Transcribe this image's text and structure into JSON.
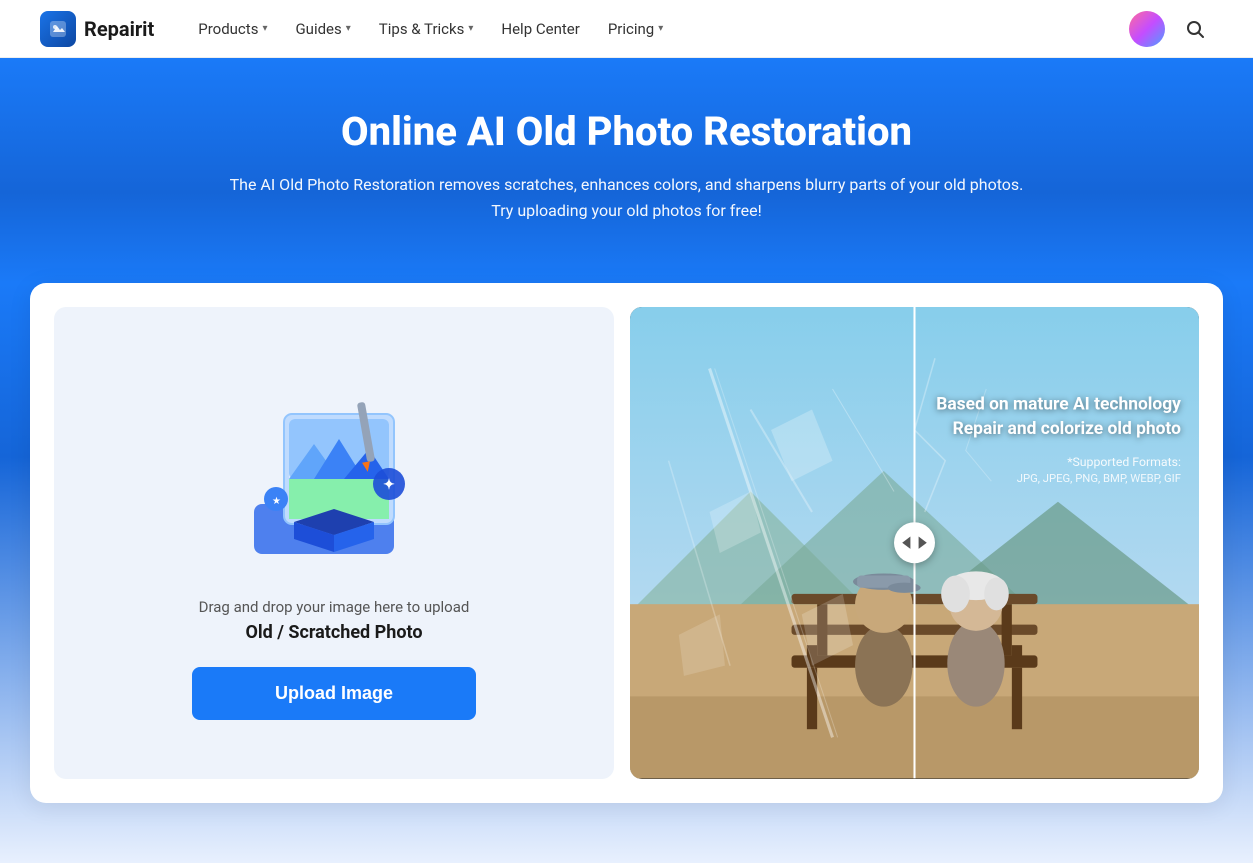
{
  "navbar": {
    "logo_text": "Repairit",
    "logo_icon": "R",
    "items": [
      {
        "label": "Products",
        "has_dropdown": true,
        "id": "products"
      },
      {
        "label": "Guides",
        "has_dropdown": true,
        "id": "guides"
      },
      {
        "label": "Tips & Tricks",
        "has_dropdown": true,
        "id": "tips-tricks"
      },
      {
        "label": "Help Center",
        "has_dropdown": false,
        "id": "help-center"
      },
      {
        "label": "Pricing",
        "has_dropdown": true,
        "id": "pricing"
      }
    ]
  },
  "hero": {
    "title": "Online AI Old Photo Restoration",
    "subtitle": "The AI Old Photo Restoration removes scratches, enhances colors, and sharpens blurry parts of your old photos. Try uploading your old photos for free!"
  },
  "upload": {
    "drag_text": "Drag and drop your image here to upload",
    "type_text": "Old / Scratched Photo",
    "button_label": "Upload Image"
  },
  "preview": {
    "overlay_line1": "Based on mature AI technology",
    "overlay_line2": "Repair and colorize old photo",
    "formats_label": "*Supported Formats:",
    "formats_list": "JPG, JPEG, PNG, BMP, WEBP, GIF"
  },
  "colors": {
    "primary": "#1a7af8",
    "hero_bg": "#1a7af8",
    "upload_bg": "#eef3fb"
  }
}
